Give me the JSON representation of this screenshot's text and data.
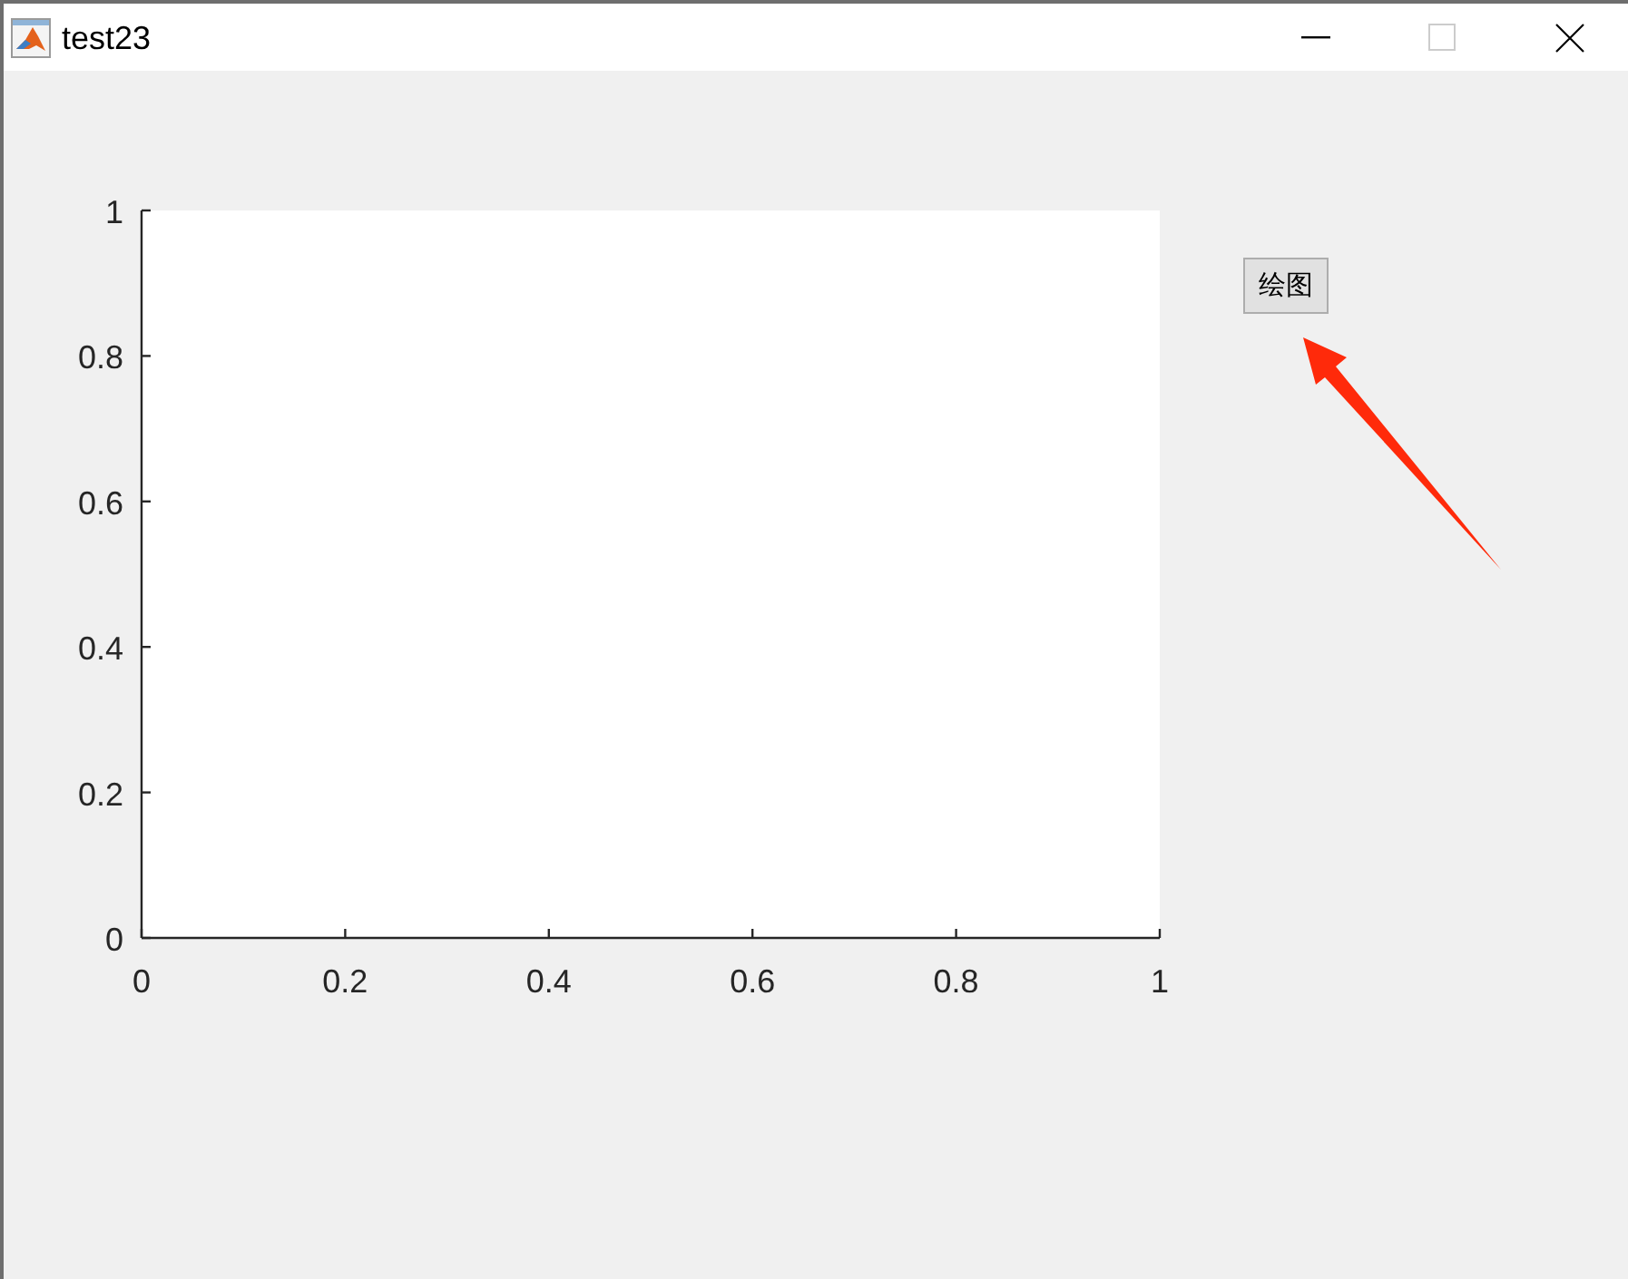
{
  "window": {
    "title": "test23",
    "maximize_disabled": true
  },
  "axes": {
    "chart_data": {
      "type": "line",
      "xlim": [
        0,
        1
      ],
      "ylim": [
        0,
        1
      ],
      "xticks": [
        0,
        0.2,
        0.4,
        0.6,
        0.8,
        1
      ],
      "yticks": [
        0,
        0.2,
        0.4,
        0.6,
        0.8,
        1
      ]
    }
  },
  "button": {
    "label": "绘图"
  }
}
